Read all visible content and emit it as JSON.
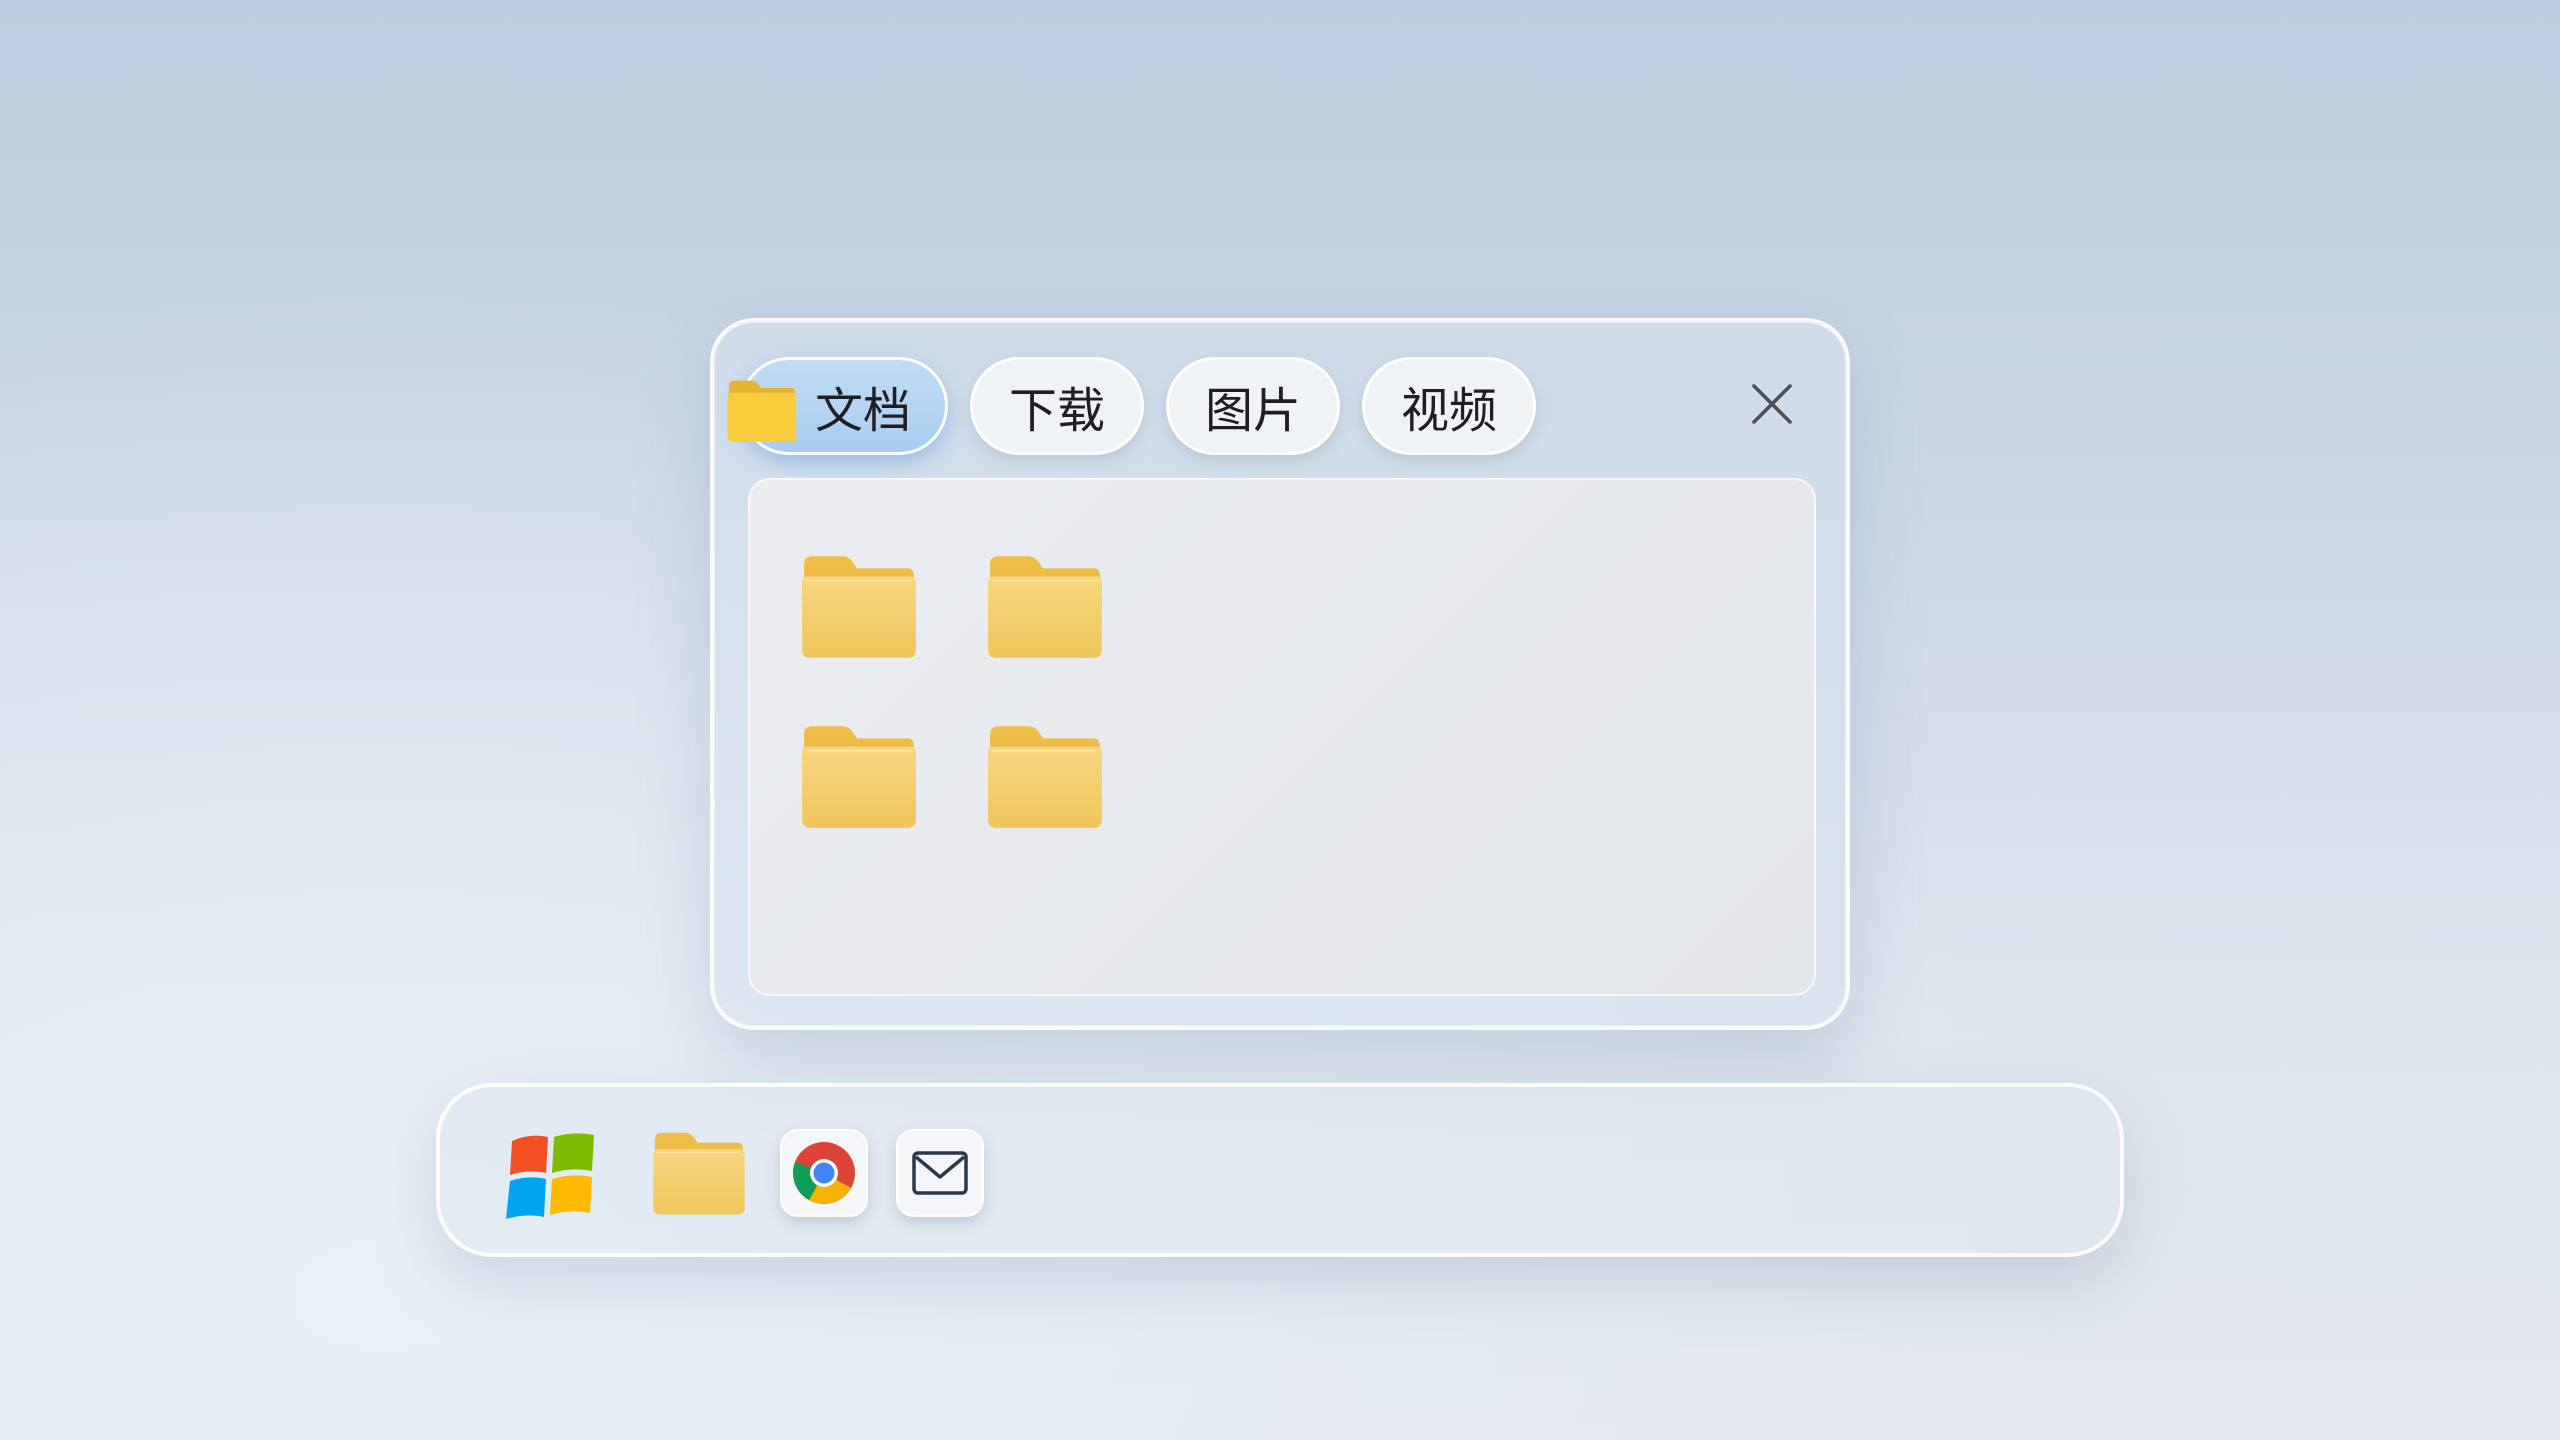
{
  "window": {
    "tabs": [
      {
        "label": "文档",
        "active": true,
        "icon": "folder-icon"
      },
      {
        "label": "下载",
        "active": false
      },
      {
        "label": "图片",
        "active": false
      },
      {
        "label": "视频",
        "active": false
      }
    ],
    "close_icon": "close-icon",
    "folders": [
      {
        "icon": "folder-icon"
      },
      {
        "icon": "folder-icon"
      },
      {
        "icon": "folder-icon"
      },
      {
        "icon": "folder-icon"
      }
    ]
  },
  "taskbar": {
    "items": [
      {
        "name": "start",
        "icon": "windows-logo-icon"
      },
      {
        "name": "file-explorer",
        "icon": "folder-icon"
      },
      {
        "name": "chrome",
        "icon": "chrome-icon"
      },
      {
        "name": "mail",
        "icon": "mail-icon"
      }
    ]
  },
  "colors": {
    "folder": "#f2c75e",
    "active_tab": "#b3d3f1",
    "windows_red": "#f25022",
    "windows_green": "#7fba00",
    "windows_blue": "#00a4ef",
    "windows_yellow": "#ffb900"
  }
}
